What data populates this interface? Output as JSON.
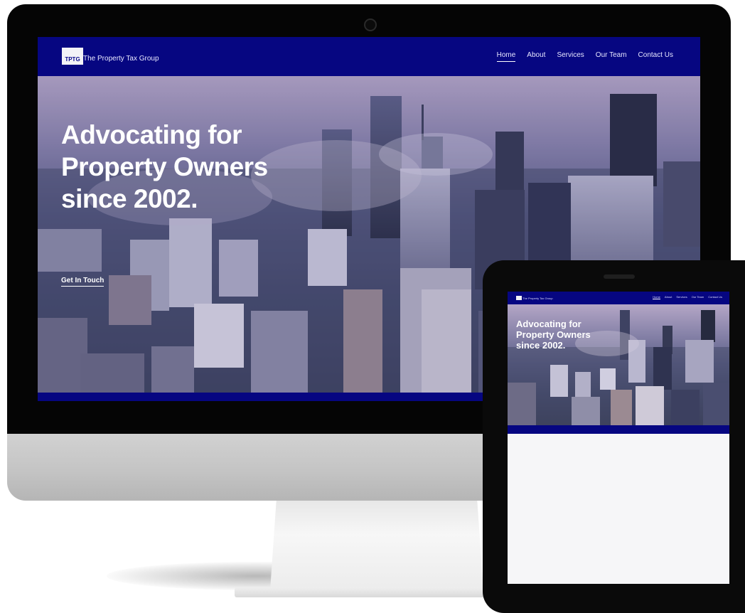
{
  "desktop": {
    "logo_text": "TPTG",
    "brand": "The Property Tax Group",
    "nav": [
      "Home",
      "About",
      "Services",
      "Our Team",
      "Contact Us"
    ],
    "active_nav": "Home",
    "hero_title": "Advocating for Property Owners since 2002.",
    "cta": "Get In Touch"
  },
  "tablet": {
    "brand": "The Property Tax Group",
    "nav": [
      "Home",
      "About",
      "Services",
      "Our Team",
      "Contact Us"
    ],
    "hero_title": "Advocating for Property Owners since 2002."
  },
  "colors": {
    "nav_bg": "#060681",
    "device_body": "#050505",
    "monitor_chin": "#c4c4c4"
  }
}
